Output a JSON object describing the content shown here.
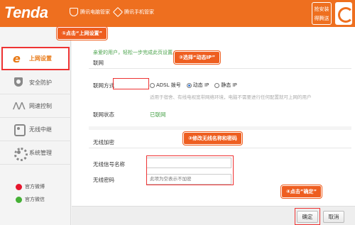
{
  "header": {
    "logo": "Tenda",
    "links": [
      "腾讯电脑管家",
      "腾讯手机管家"
    ],
    "install_button": [
      "抢安装",
      "得腾送"
    ]
  },
  "sidebar": {
    "items": [
      {
        "label": "上网设置",
        "icon": "ie-icon"
      },
      {
        "label": "安全防护",
        "icon": "shield-icon"
      },
      {
        "label": "网速控制",
        "icon": "wave-icon"
      },
      {
        "label": "无线中继",
        "icon": "wifi-repeater-icon"
      },
      {
        "label": "系统管理",
        "icon": "gear-icon"
      }
    ],
    "social": [
      "官方微博",
      "官方微信"
    ]
  },
  "main": {
    "welcome": "亲爱的用户，轻松一步完成此页设置。",
    "network_section": "联网",
    "connection_label": "联网方式",
    "options": [
      "ADSL 拨号",
      "动态 IP",
      "静态 IP"
    ],
    "selected_option": "动态 IP",
    "hint": "适用于宿舍、有线电视宽带网络环境，电脑不需要进行任何配置就可上网的用户",
    "status_label": "联网状态",
    "status_value": "已联网",
    "wireless_section": "无线加密",
    "ssid_label": "无线信号名称",
    "ssid_value": "",
    "password_label": "无线密码",
    "password_placeholder": "此项为空表示不加密"
  },
  "callouts": {
    "step1": "①点击“上网设置”",
    "step2": "②选择“动态IP”",
    "step3": "③修改无线名称和密码",
    "step4": "④点击”确定”"
  },
  "footer": {
    "confirm": "确定",
    "cancel": "取消"
  },
  "colors": {
    "brand_orange": "#ee6f1f",
    "highlight_red": "#e33333",
    "status_green": "#49a24a"
  }
}
